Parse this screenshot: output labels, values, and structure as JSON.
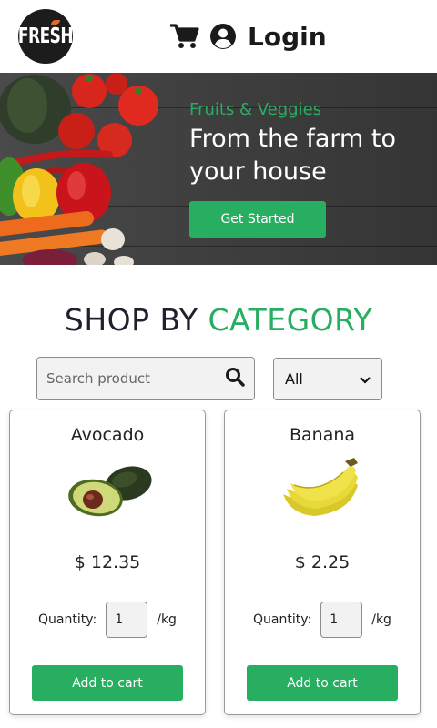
{
  "header": {
    "logo_text": "FRESH",
    "login_label": "Login",
    "icons": [
      "cart-icon",
      "user-circle-icon"
    ]
  },
  "hero": {
    "subtitle": "Fruits & Veggies",
    "title_line1": "From the farm to",
    "title_line2": "your house",
    "cta_label": "Get Started"
  },
  "category": {
    "title_part1": "SHOP BY",
    "title_part2": "CATEGORY"
  },
  "search": {
    "placeholder": "Search product",
    "filter_value": "All"
  },
  "products": [
    {
      "name": "Avocado",
      "price": "$ 12.35",
      "quantity_label": "Quantity:",
      "quantity": "1",
      "unit": "/kg",
      "add_label": "Add to cart"
    },
    {
      "name": "Banana",
      "price": "$ 2.25",
      "quantity_label": "Quantity:",
      "quantity": "1",
      "unit": "/kg",
      "add_label": "Add to cart"
    }
  ],
  "colors": {
    "accent": "#27ae60",
    "dark_text": "#1f1f2e"
  }
}
